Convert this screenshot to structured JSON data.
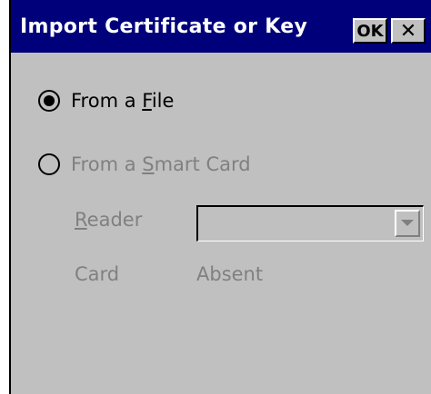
{
  "dialog": {
    "title": "Import Certificate or Key",
    "ok_label": "OK",
    "close_label": "✕"
  },
  "options": {
    "from_file": {
      "prefix": "From a ",
      "accel": "F",
      "suffix": "ile",
      "checked": true
    },
    "from_smart_card": {
      "prefix": "From a ",
      "accel": "S",
      "suffix": "mart Card",
      "checked": false,
      "enabled": false
    }
  },
  "reader": {
    "accel": "R",
    "suffix": "eader",
    "value": ""
  },
  "card": {
    "label": "Card",
    "value": "Absent"
  },
  "colors": {
    "titlebar": "#00007b",
    "face": "#c0c0c0",
    "disabled_text": "#808080"
  },
  "icons": {
    "dropdown": "chevron-down-icon",
    "close": "close-icon"
  }
}
